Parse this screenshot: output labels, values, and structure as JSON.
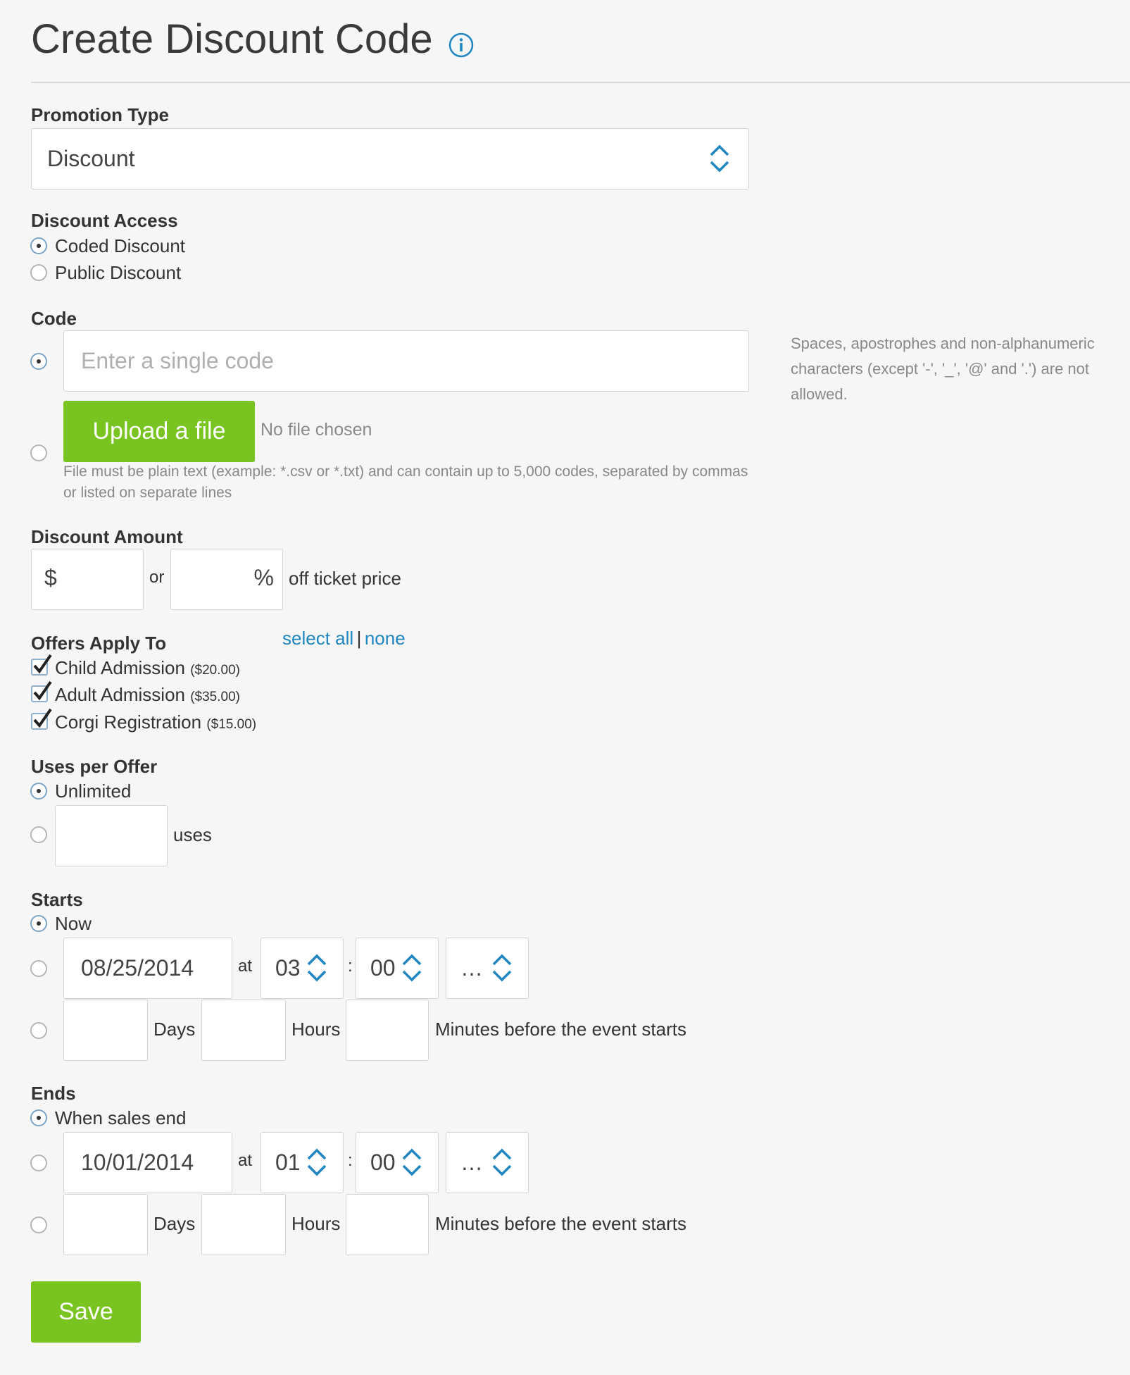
{
  "page": {
    "title": "Create Discount Code"
  },
  "icons": {
    "info": "info-icon",
    "select_arrows": "up-down-chevron-icon",
    "check": "checkmark-icon"
  },
  "colors": {
    "accent_green": "#79c421",
    "link_blue": "#1f86c1",
    "background": "#f6f6f6"
  },
  "promotion_type": {
    "label": "Promotion Type",
    "selected": "Discount"
  },
  "discount_access": {
    "label": "Discount Access",
    "options": [
      {
        "label": "Coded Discount",
        "selected": true
      },
      {
        "label": "Public Discount",
        "selected": false
      }
    ]
  },
  "code": {
    "label": "Code",
    "single_placeholder": "Enter a single code",
    "upload_label": "Upload a file",
    "no_file": "No file chosen",
    "file_note": "File must be plain text (example: *.csv or *.txt) and can contain up to 5,000 codes, separated by commas or listed on separate lines",
    "help": "Spaces, apostrophes and non-alphanumeric characters (except '-', '_', '@' and '.') are not allowed."
  },
  "discount_amount": {
    "label": "Discount Amount",
    "currency_symbol": "$",
    "or_text": "or",
    "percent_symbol": "%",
    "suffix": "off ticket price"
  },
  "offers": {
    "label": "Offers Apply To",
    "select_all": "select all",
    "separator": "|",
    "none": "none",
    "items": [
      {
        "name": "Child Admission",
        "price": "($20.00)",
        "checked": true
      },
      {
        "name": "Adult Admission",
        "price": "($35.00)",
        "checked": true
      },
      {
        "name": "Corgi Registration",
        "price": "($15.00)",
        "checked": true
      }
    ]
  },
  "uses": {
    "label": "Uses per Offer",
    "unlimited": "Unlimited",
    "uses_suffix": "uses"
  },
  "starts": {
    "label": "Starts",
    "now": "Now",
    "date": "08/25/2014",
    "at": "at",
    "hour": "03",
    "colon": ":",
    "minute": "00",
    "ampm": "…",
    "days": "Days",
    "hours": "Hours",
    "minutes_before": "Minutes before the event starts"
  },
  "ends": {
    "label": "Ends",
    "when_sales_end": "When sales end",
    "date": "10/01/2014",
    "at": "at",
    "hour": "01",
    "colon": ":",
    "minute": "00",
    "ampm": "…",
    "days": "Days",
    "hours": "Hours",
    "minutes_before": "Minutes before the event starts"
  },
  "save_label": "Save"
}
